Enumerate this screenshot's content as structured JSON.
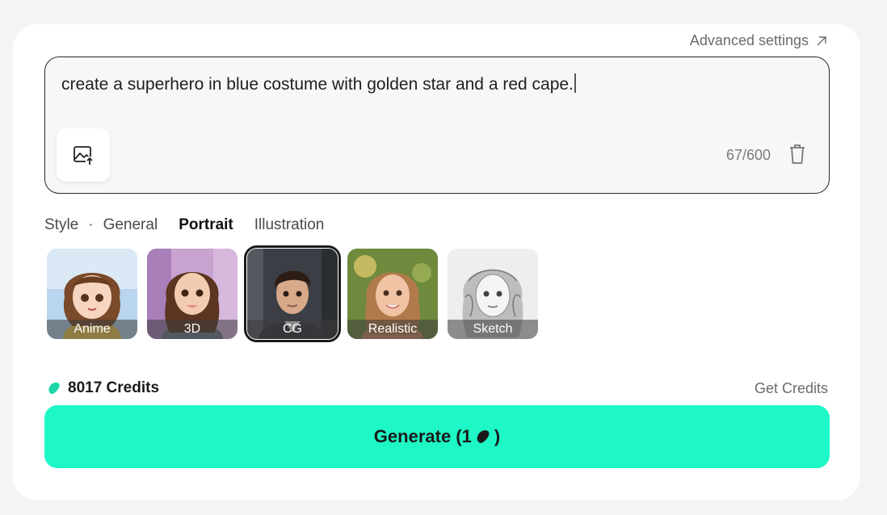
{
  "header": {
    "advanced_settings_label": "Advanced settings"
  },
  "prompt": {
    "text": "create a superhero in blue costume with golden star and a red cape.",
    "char_count": "67/600"
  },
  "style": {
    "label": "Style",
    "separator": "·",
    "tabs": [
      {
        "label": "General",
        "active": false
      },
      {
        "label": "Portrait",
        "active": true
      },
      {
        "label": "Illustration",
        "active": false
      }
    ],
    "presets": [
      {
        "label": "Anime",
        "selected": false
      },
      {
        "label": "3D",
        "selected": false
      },
      {
        "label": "CG",
        "selected": true
      },
      {
        "label": "Realistic",
        "selected": false
      },
      {
        "label": "Sketch",
        "selected": false
      }
    ]
  },
  "credits": {
    "balance_label": "8017 Credits",
    "get_label": "Get Credits"
  },
  "generate": {
    "label_prefix": "Generate (1",
    "label_suffix": ")"
  },
  "colors": {
    "accent": "#1ef7c6",
    "bean": "#1ed6a8"
  },
  "icons": [
    "external-arrow-icon",
    "image-upload-icon",
    "trash-icon",
    "credit-bean-icon"
  ]
}
